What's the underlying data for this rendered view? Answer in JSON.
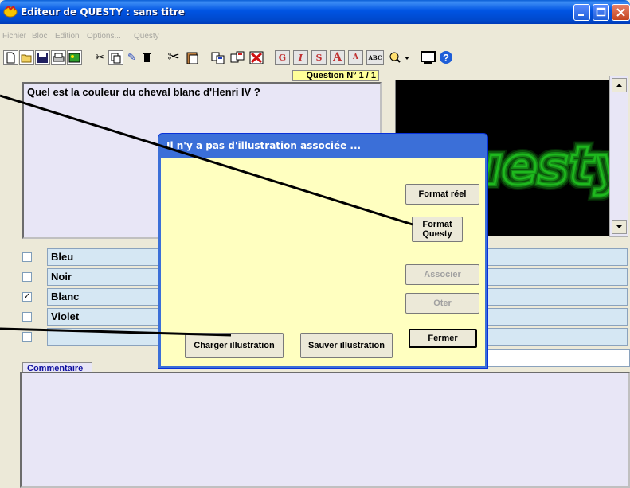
{
  "window": {
    "title": "Editeur de QUESTY : sans titre",
    "app_icon": "questy-app-icon"
  },
  "menu": {
    "items": [
      "Fichier",
      "Bloc",
      "Edition",
      "Options...",
      "Questy"
    ]
  },
  "toolbar": {
    "format_buttons": [
      "G",
      "I",
      "S",
      "A",
      "A",
      "ABC"
    ]
  },
  "question": {
    "number_label": "Question N° 1 / 1",
    "text": "Quel est la couleur du cheval blanc d'Henri IV ?"
  },
  "image_panel": {
    "logo_text": "Questy",
    "logo_color": "#1fbf1f"
  },
  "answers": [
    {
      "text": "Bleu",
      "checked": false
    },
    {
      "text": "Noir",
      "checked": false
    },
    {
      "text": "Blanc",
      "checked": true
    },
    {
      "text": "Violet",
      "checked": false
    },
    {
      "text": "",
      "checked": false
    }
  ],
  "comment": {
    "tab_label": "Commentaire",
    "text": ""
  },
  "dialog": {
    "title": "Il n'y a pas d'illustration associée ...",
    "buttons": {
      "format_reel": "Format réel",
      "format_questy": "Format\nQuesty",
      "associer": "Associer",
      "oter": "Oter",
      "fermer": "Fermer",
      "charger": "Charger illustration",
      "sauver": "Sauver illustration"
    }
  }
}
